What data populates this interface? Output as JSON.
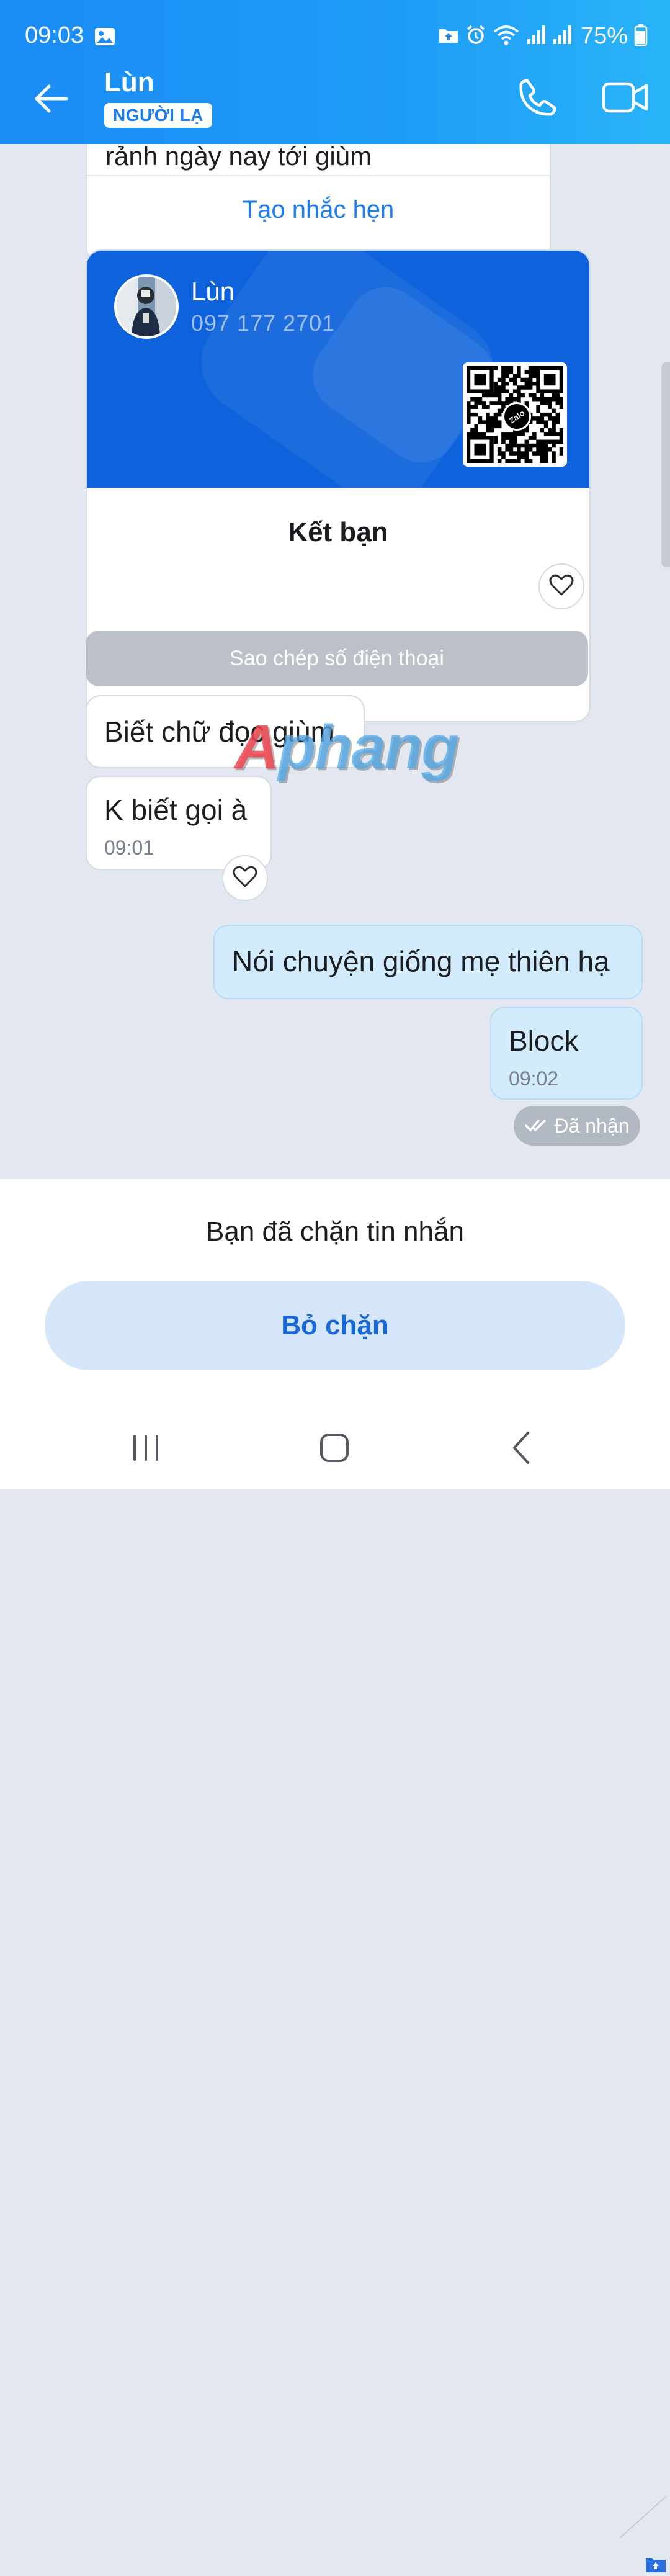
{
  "status_bar": {
    "time": "09:03",
    "battery": "75%",
    "icons": [
      "gallery-icon",
      "upload-icon",
      "alarm-icon",
      "wifi-icon",
      "signal-icon",
      "signal-icon",
      "battery-icon"
    ]
  },
  "header": {
    "contact_name": "Lùn",
    "badge": "NGƯỜI LẠ",
    "actions": [
      "back-arrow-icon",
      "phone-icon",
      "video-camera-icon"
    ]
  },
  "reminder_card": {
    "text": "rảnh ngày nay tới giùm",
    "link": "Tạo nhắc hẹn"
  },
  "contact_card": {
    "name": "Lùn",
    "phone": "097 177 2701",
    "qr_logo": "Zalo",
    "add_friend": "Kết bạn"
  },
  "copy_phone": "Sao chép số điện thoại",
  "messages": [
    {
      "direction": "in",
      "text": "Biết chữ đọc giùm",
      "time": ""
    },
    {
      "direction": "in",
      "text": "K biết gọi à",
      "time": "09:01"
    },
    {
      "direction": "out",
      "text": "Nói chuyện giống mẹ thiên hạ",
      "time": ""
    },
    {
      "direction": "out",
      "text": "Block",
      "time": "09:02"
    }
  ],
  "delivery_status": "Đã nhận",
  "watermark": {
    "part1": "A",
    "part2": "phang"
  },
  "blocked": {
    "text": "Bạn đã chặn tin nhắn",
    "unblock": "Bỏ chặn"
  },
  "system_nav": [
    "recent-apps-icon",
    "home-icon",
    "back-icon"
  ],
  "colors": {
    "header": "#1a8cf6",
    "card_blue": "#0e63dc",
    "out_bubble": "#d3ecfd",
    "unblock_bg": "#d5e6fb",
    "accent": "#1a7ef0"
  }
}
